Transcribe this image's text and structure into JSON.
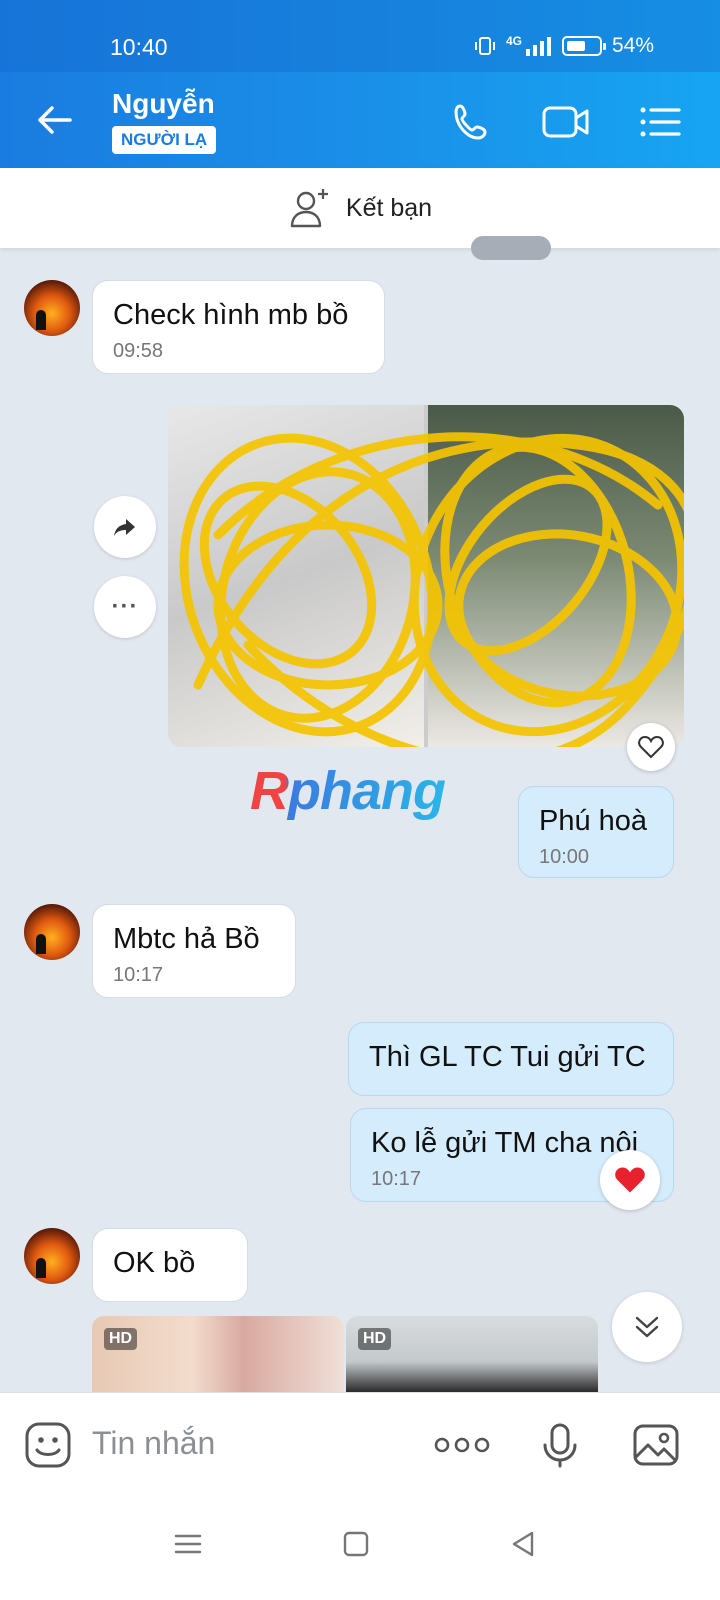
{
  "status_bar": {
    "time": "10:40",
    "network": "4G",
    "battery": "54%"
  },
  "header": {
    "contact_name": "Nguyễn",
    "badge": "NGƯỜI LẠ"
  },
  "friend_bar": {
    "label": "Kết bạn"
  },
  "messages": [
    {
      "direction": "in",
      "text": "Check hình mb bồ",
      "time": "09:58"
    },
    {
      "direction": "out",
      "type": "photo"
    },
    {
      "direction": "out",
      "text": "Phú hoà",
      "time": "10:00"
    },
    {
      "direction": "in",
      "text": "Mbtc hả Bồ",
      "time": "10:17"
    },
    {
      "direction": "out",
      "text": "Thì GL TC Tui gửi TC"
    },
    {
      "direction": "out",
      "text": "Ko lễ gửi TM cha nội",
      "time": "10:17",
      "reaction": "heart"
    },
    {
      "direction": "in",
      "text": "OK bồ"
    },
    {
      "direction": "in",
      "type": "photos",
      "badges": [
        "HD",
        "HD"
      ]
    }
  ],
  "watermark": "Rphang",
  "composer": {
    "placeholder": "Tin nhắn"
  },
  "colors": {
    "header": "#1a8fe8",
    "outgoing_bubble": "#d5ecfc",
    "incoming_bubble": "#ffffff",
    "background": "#e2e8ef"
  }
}
